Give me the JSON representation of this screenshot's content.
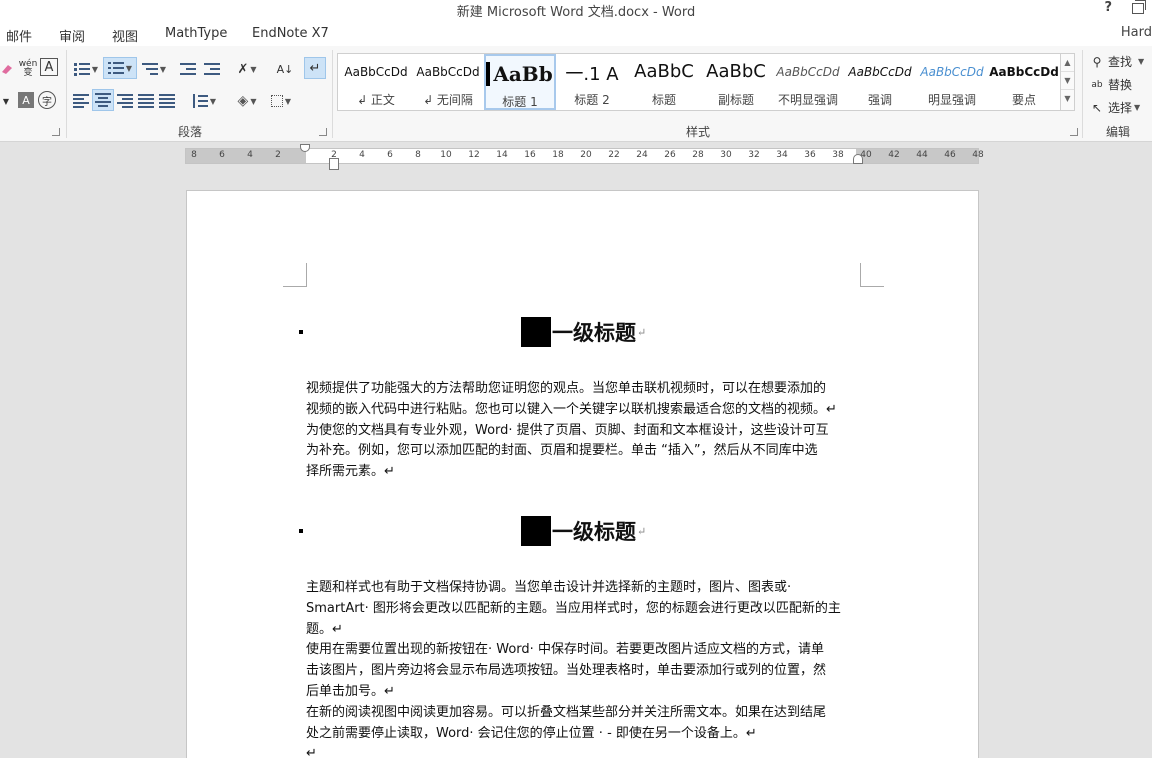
{
  "window": {
    "title": "新建 Microsoft Word 文档.docx - Word",
    "help": "?",
    "account": "Hard"
  },
  "tabs": [
    "邮件",
    "审阅",
    "视图",
    "MathType",
    "EndNote X7"
  ],
  "ribbon": {
    "groups": {
      "paragraph": "段落",
      "styles": "样式",
      "editing": "编辑"
    },
    "styles_gallery": [
      {
        "sample": "AaBbCcDd",
        "name": "↲ 正文"
      },
      {
        "sample": "AaBbCcDd",
        "name": "↲ 无间隔"
      },
      {
        "sample": "AaBb",
        "name": "标题 1"
      },
      {
        "sample": "一.1 A",
        "name": "标题 2"
      },
      {
        "sample": "AaBbC",
        "name": "标题"
      },
      {
        "sample": "AaBbC",
        "name": "副标题"
      },
      {
        "sample": "AaBbCcDd",
        "name": "不明显强调"
      },
      {
        "sample": "AaBbCcDd",
        "name": "强调"
      },
      {
        "sample": "AaBbCcDd",
        "name": "明显强调"
      },
      {
        "sample": "AaBbCcDd",
        "name": "要点"
      }
    ],
    "editing": {
      "find": "查找",
      "replace": "替换",
      "select": "选择"
    },
    "font_icons": {
      "phonetic": "wén",
      "phonetic_base": "变",
      "char_box": "A",
      "char_shade": "A",
      "enclose": "字"
    }
  },
  "ruler": {
    "ticks": [
      "8",
      "6",
      "4",
      "2",
      "",
      "2",
      "4",
      "6",
      "8",
      "10",
      "12",
      "14",
      "16",
      "18",
      "20",
      "22",
      "24",
      "26",
      "28",
      "30",
      "32",
      "34",
      "36",
      "38",
      "40",
      "42",
      "44",
      "46",
      "48"
    ]
  },
  "document": {
    "headings": [
      "一级标题",
      "一级标题"
    ],
    "paragraph_mark": "↵",
    "para1_lines": [
      "视频提供了功能强大的方法帮助您证明您的观点。当您单击联机视频时，可以在想要添加的",
      "视频的嵌入代码中进行粘贴。您也可以键入一个关键字以联机搜索最适合您的文档的视频。↵",
      "为使您的文档具有专业外观，Word· 提供了页眉、页脚、封面和文本框设计，这些设计可互",
      "为补充。例如，您可以添加匹配的封面、页眉和提要栏。单击 “插入”，然后从不同库中选",
      "择所需元素。↵"
    ],
    "para2_lines": [
      "主题和样式也有助于文档保持协调。当您单击设计并选择新的主题时，图片、图表或·",
      "SmartArt· 图形将会更改以匹配新的主题。当应用样式时，您的标题会进行更改以匹配新的主",
      "题。↵",
      "使用在需要位置出现的新按钮在· Word· 中保存时间。若要更改图片适应文档的方式，请单",
      "击该图片，图片旁边将会显示布局选项按钮。当处理表格时，单击要添加行或列的位置，然",
      "后单击加号。↵",
      "在新的阅读视图中阅读更加容易。可以折叠文档某些部分并关注所需文本。如果在达到结尾",
      "处之前需要停止读取，Word· 会记住您的停止位置 · - 即使在另一个设备上。↵",
      "↵"
    ]
  }
}
